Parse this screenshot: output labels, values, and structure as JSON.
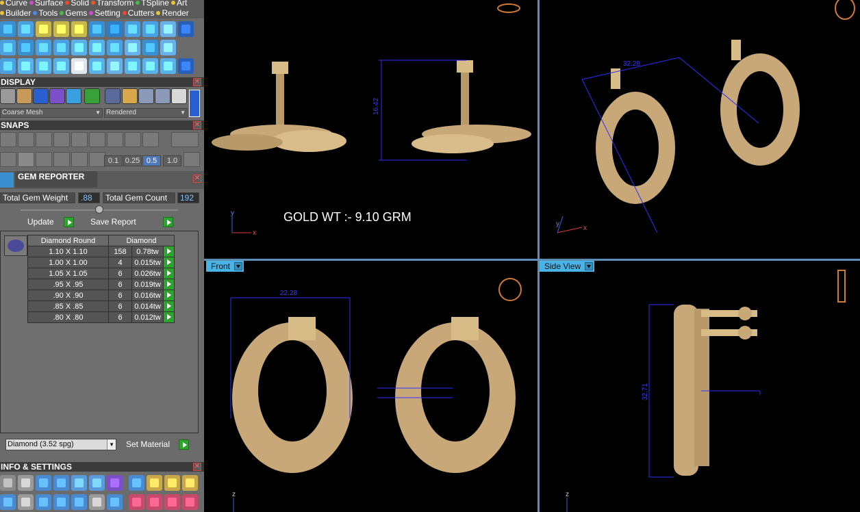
{
  "menus": {
    "row1": [
      {
        "label": "Curve",
        "color": "#e8c23a"
      },
      {
        "label": "Surface",
        "color": "#d04bd0"
      },
      {
        "label": "Solid",
        "color": "#e84a2a"
      },
      {
        "label": "Transform",
        "color": "#e85a2a"
      },
      {
        "label": "TSpline",
        "color": "#4ab84a"
      },
      {
        "label": "Art",
        "color": "#e8c23a"
      }
    ],
    "row2": [
      {
        "label": "Builder",
        "color": "#e8c23a"
      },
      {
        "label": "Tools",
        "color": "#4a8ae8"
      },
      {
        "label": "Gems",
        "color": "#4ab84a"
      },
      {
        "label": "Setting",
        "color": "#d04bd0"
      },
      {
        "label": "Cutters",
        "color": "#e84a2a"
      },
      {
        "label": "Render",
        "color": "#e8c23a"
      }
    ]
  },
  "display": {
    "title": "DISPLAY",
    "mesh_value": "Coarse Mesh",
    "render_value": "Rendered"
  },
  "snaps": {
    "title": "SNAPS",
    "values": [
      "0.1",
      "0.25",
      "0.5",
      "1.0"
    ],
    "selected": "0.5"
  },
  "gem_reporter": {
    "title": "GEM REPORTER",
    "total_weight_label": "Total Gem Weight",
    "total_weight_value": ".88",
    "total_count_label": "Total Gem Count",
    "total_count_value": "192",
    "update_label": "Update",
    "save_report_label": "Save Report",
    "table_headers": [
      "Diamond Round",
      "Diamond"
    ],
    "rows": [
      {
        "size": "1.10 X 1.10",
        "count": "158",
        "weight": "0.78tw"
      },
      {
        "size": "1.00 X 1.00",
        "count": "4",
        "weight": "0.015tw"
      },
      {
        "size": "1.05 X 1.05",
        "count": "6",
        "weight": "0.026tw"
      },
      {
        "size": ".95 X .95",
        "count": "6",
        "weight": "0.019tw"
      },
      {
        "size": ".90 X .90",
        "count": "6",
        "weight": "0.016tw"
      },
      {
        "size": ".85 X .85",
        "count": "6",
        "weight": "0.014tw"
      },
      {
        "size": ".80 X .80",
        "count": "6",
        "weight": "0.012tw"
      }
    ],
    "material_value": "Diamond    (3.52 spg)",
    "set_material_label": "Set Material"
  },
  "info_settings": {
    "title": "INFO & SETTINGS"
  },
  "viewports": {
    "top_left": {
      "annotation": "GOLD WT :- 9.10 GRM",
      "dim_label": "16.42",
      "axis_y": "y",
      "axis_x": "x"
    },
    "top_right": {
      "dim_label": "32.28",
      "axis_y": "y",
      "axis_x": "x"
    },
    "bottom_left": {
      "label": "Front",
      "dim_label": "22.28",
      "axis_z": "z"
    },
    "bottom_right": {
      "label": "Side View",
      "dim_label": "32.71",
      "axis_z": "z"
    }
  },
  "colors": {
    "accent": "#4ab3e6",
    "panel": "#6b6b6b",
    "gold": "#c8a878",
    "dimension": "#2e2eff"
  }
}
